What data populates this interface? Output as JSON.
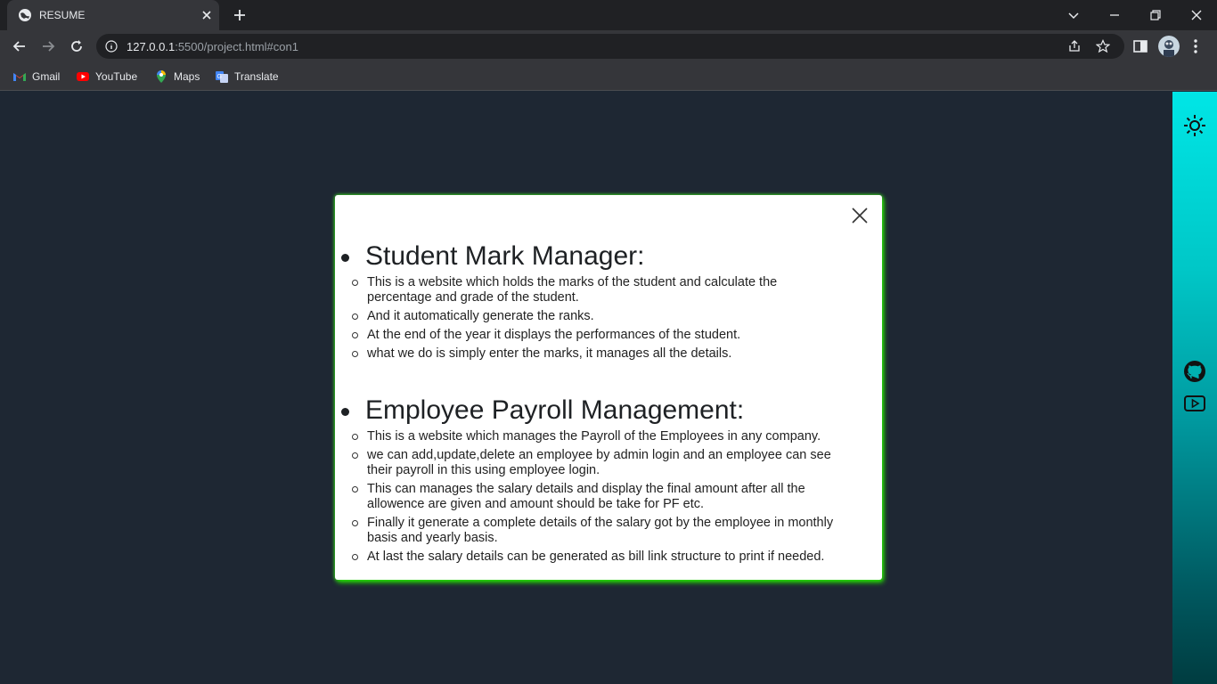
{
  "browser": {
    "tab_title": "RESUME",
    "url_host": "127.0.0.1",
    "url_rest": ":5500/project.html#con1",
    "bookmarks": [
      {
        "label": "Gmail",
        "icon": "gmail-icon"
      },
      {
        "label": "YouTube",
        "icon": "youtube-icon"
      },
      {
        "label": "Maps",
        "icon": "maps-icon"
      },
      {
        "label": "Translate",
        "icon": "translate-icon"
      }
    ]
  },
  "sidebar": {
    "icons": [
      "theme-toggle-sun-icon",
      "github-icon",
      "youtube-icon"
    ],
    "gradient_top": "#00e6e6",
    "gradient_bottom": "#003c40"
  },
  "modal": {
    "accent_shadow": "#22dd00",
    "projects": [
      {
        "title": "Student Mark Manager:",
        "points": [
          "This is a website which holds the marks of the student and calculate the percentage and grade of the student.",
          "And it automatically generate the ranks.",
          "At the end of the year it displays the performances of the student.",
          "what we do is simply enter the marks, it manages all the details."
        ]
      },
      {
        "title": "Employee Payroll Management:",
        "points": [
          "This is a website which manages the Payroll of the Employees in any company.",
          "we can add,update,delete an employee by admin login and an employee can see their payroll in this using employee login.",
          "This can manages the salary details and display the final amount after all the allowence are given and amount should be take for PF etc.",
          "Finally it generate a complete details of the salary got by the employee in monthly basis and yearly basis.",
          "At last the salary details can be generated as bill link structure to print if needed."
        ]
      }
    ]
  }
}
